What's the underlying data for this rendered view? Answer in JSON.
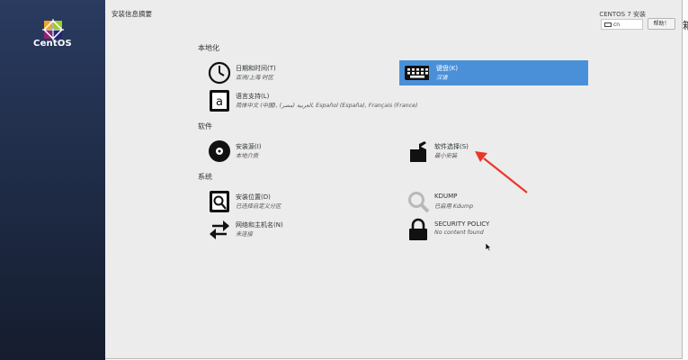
{
  "sidebar": {
    "logo_text": "CentOS"
  },
  "header": {
    "page_title": "安装信息摘要",
    "install_title": "CENTOS 7 安装",
    "keyboard_layout": "cn",
    "help_label": "帮助！"
  },
  "sections": {
    "localization": {
      "title": "本地化",
      "datetime": {
        "title": "日期和时间(T)",
        "status": "亚洲/上海 时区"
      },
      "keyboard": {
        "title": "键盘(K)",
        "status": "汉语"
      },
      "language": {
        "title": "语言支持(L)",
        "status": "简体中文 (中国), العربية (مصر), Español (España), Français (France)"
      }
    },
    "software": {
      "title": "软件",
      "source": {
        "title": "安装源(I)",
        "status": "本地介质"
      },
      "selection": {
        "title": "软件选择(S)",
        "status": "最小安装"
      }
    },
    "system": {
      "title": "系统",
      "destination": {
        "title": "安装位置(D)",
        "status": "已选择自定义分区"
      },
      "kdump": {
        "title": "KDUMP",
        "status": "已启用 Kdump"
      },
      "network": {
        "title": "网络和主机名(N)",
        "status": "未连接"
      },
      "security": {
        "title": "SECURITY POLICY",
        "status": "No content found"
      }
    }
  },
  "edge_text": "箱",
  "colors": {
    "selected": "#4a90d9",
    "sidebar": "#1e2a44",
    "annotation_arrow": "#e8382e"
  }
}
